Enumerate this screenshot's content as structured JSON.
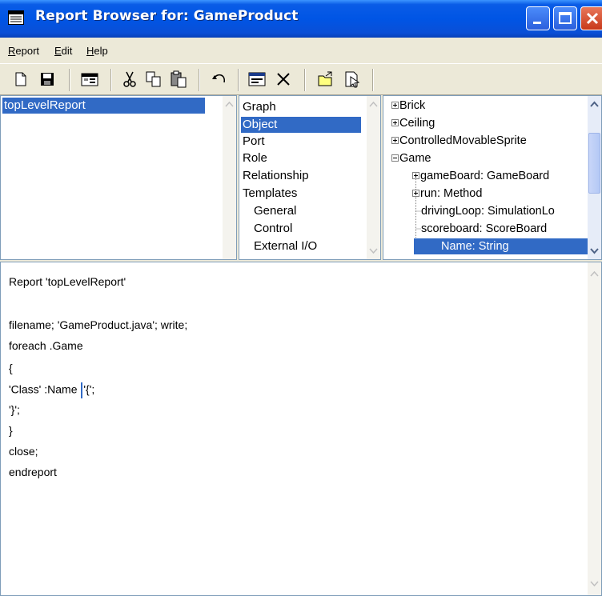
{
  "window": {
    "title": "Report Browser for: GameProduct"
  },
  "menu": [
    {
      "label": "Report",
      "accel": "R",
      "rest": "eport"
    },
    {
      "label": "Edit",
      "accel": "E",
      "rest": "dit"
    },
    {
      "label": "Help",
      "accel": "H",
      "rest": "elp"
    }
  ],
  "toolbar": {
    "buttons": [
      "new-icon",
      "save-icon",
      "properties-icon",
      "cut-icon",
      "copy-icon",
      "paste-icon",
      "undo-icon",
      "window-icon",
      "delete-icon",
      "open-folder-icon",
      "report-run-icon"
    ]
  },
  "reports": {
    "selected": "topLevelReport"
  },
  "types": {
    "items": [
      "Graph",
      "Object",
      "Port",
      "Role",
      "Relationship",
      "Templates",
      "General",
      "Control",
      "External I/O"
    ],
    "selected": "Object"
  },
  "tree": {
    "items": [
      {
        "label": "Brick",
        "expander": "plus"
      },
      {
        "label": "Ceiling",
        "expander": "plus"
      },
      {
        "label": "ControlledMovableSprite",
        "expander": "plus"
      },
      {
        "label": "Game",
        "expander": "minus"
      },
      {
        "label": "gameBoard: GameBoard",
        "expander": "plus"
      },
      {
        "label": "run: Method",
        "expander": "plus"
      },
      {
        "label": "drivingLoop: SimulationLo",
        "expander": "none"
      },
      {
        "label": "scoreboard: ScoreBoard",
        "expander": "none"
      },
      {
        "label": "Name: String",
        "expander": "none",
        "selected": true
      }
    ]
  },
  "editor": {
    "lines": [
      "Report 'topLevelReport'",
      "",
      "filename; 'GameProduct.java'; write;",
      "foreach .Game",
      "{",
      "'Class' :Name ",
      "'}';",
      "}",
      "close;",
      "endreport"
    ],
    "line5_after_cursor": "'{';"
  },
  "colors": {
    "titlebar": "#0055e5",
    "selection": "#316ac5",
    "chrome": "#ece9d8"
  }
}
